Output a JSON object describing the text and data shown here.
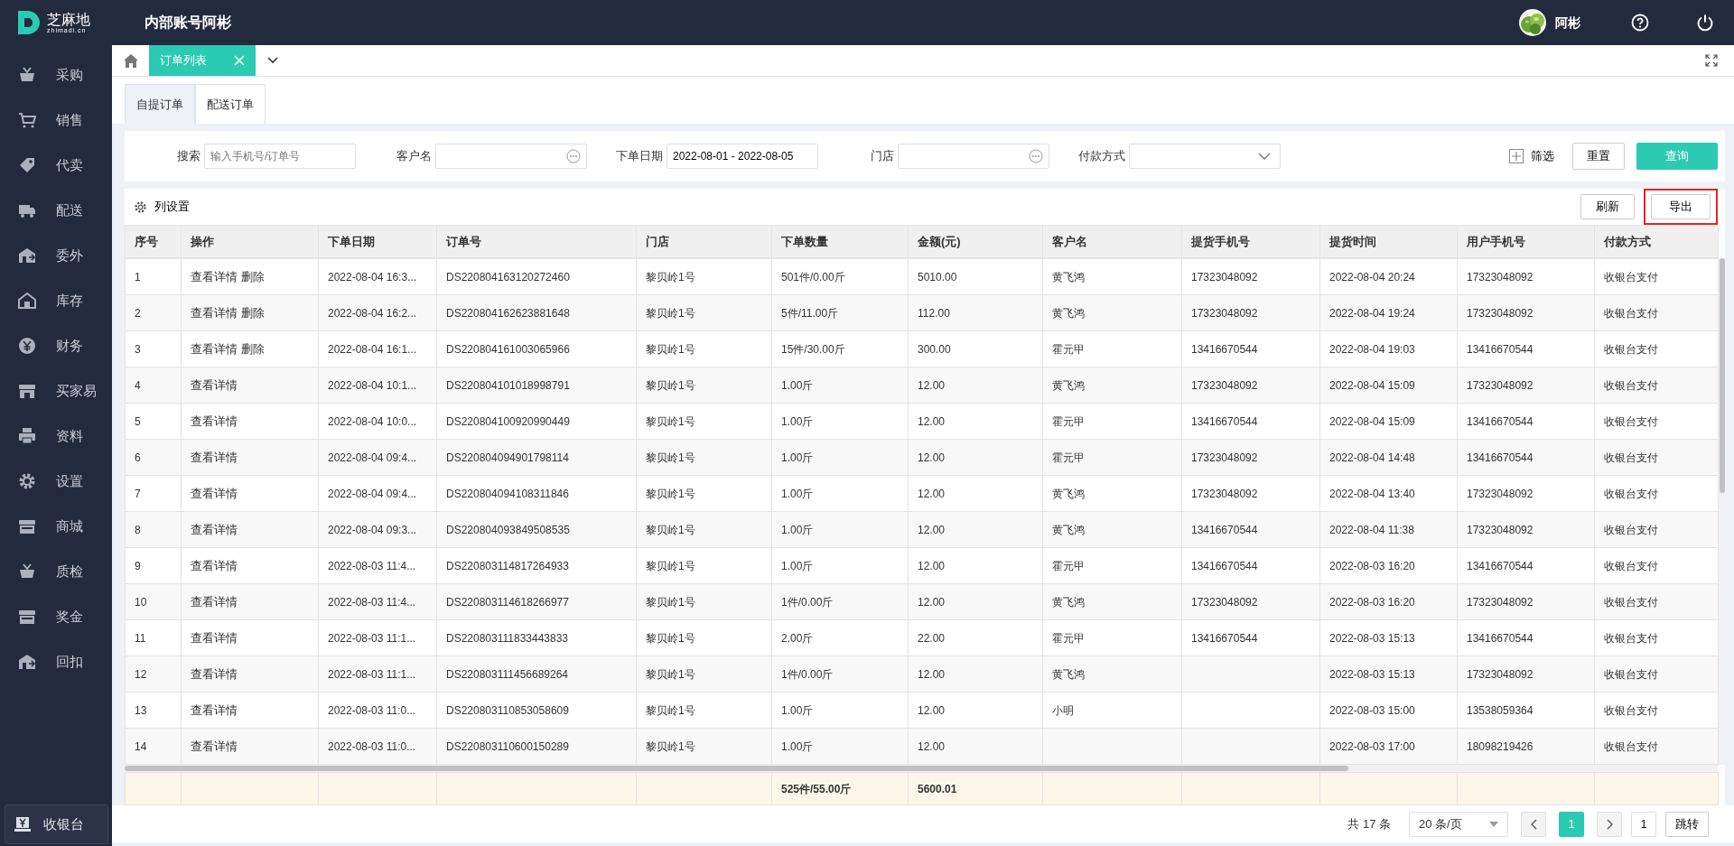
{
  "app": {
    "logo_name": "芝麻地",
    "logo_domain": "zhimadi.cn",
    "account_title": "内部账号阿彬",
    "user_name": "阿彬"
  },
  "sidebar": {
    "items": [
      {
        "label": "采购"
      },
      {
        "label": "销售"
      },
      {
        "label": "代卖"
      },
      {
        "label": "配送"
      },
      {
        "label": "委外"
      },
      {
        "label": "库存"
      },
      {
        "label": "财务"
      },
      {
        "label": "买家易"
      },
      {
        "label": "资料"
      },
      {
        "label": "设置"
      },
      {
        "label": "商城"
      },
      {
        "label": "质检"
      },
      {
        "label": "奖金"
      },
      {
        "label": "回扣"
      }
    ],
    "cashier_button": "收银台"
  },
  "page_tabs": [
    {
      "label": "订单列表",
      "selected": true
    }
  ],
  "order_tabs": [
    {
      "label": "自提订单",
      "selected": true
    },
    {
      "label": "配送订单",
      "selected": false
    }
  ],
  "filters": [
    {
      "kind": "text",
      "label": "搜索",
      "placeholder": "输入手机号/订单号"
    },
    {
      "kind": "picker",
      "label": "客户名"
    },
    {
      "kind": "text",
      "label": "下单日期",
      "value": "2022-08-01 - 2022-08-05"
    },
    {
      "kind": "picker",
      "label": "门店"
    },
    {
      "kind": "select",
      "label": "付款方式"
    }
  ],
  "filter_actions": {
    "more": "筛选",
    "reset": "重置",
    "query": "查询"
  },
  "toolbar": {
    "column_settings": "列设置",
    "refresh": "刷新",
    "export": "导出",
    "export_highlighted": true
  },
  "table": {
    "columns": [
      "序号",
      "操作",
      "下单日期",
      "订单号",
      "门店",
      "下单数量",
      "金额(元)",
      "客户名",
      "提货手机号",
      "提货时间",
      "用户手机号",
      "付款方式"
    ],
    "rows": [
      {
        "cells": [
          "1",
          [
            "查看详情",
            "删除"
          ],
          "2022-08-04 16:3...",
          "DS220804163120272460",
          "黎贝岭1号",
          "501件/0.00斤",
          "5010.00",
          "黄飞鸿",
          "17323048092",
          "2022-08-04 20:24",
          "17323048092",
          "收银台支付"
        ]
      },
      {
        "cells": [
          "2",
          [
            "查看详情",
            "删除"
          ],
          "2022-08-04 16:2...",
          "DS220804162623881648",
          "黎贝岭1号",
          "5件/11.00斤",
          "112.00",
          "黄飞鸿",
          "17323048092",
          "2022-08-04 19:24",
          "17323048092",
          "收银台支付"
        ]
      },
      {
        "cells": [
          "3",
          [
            "查看详情",
            "删除"
          ],
          "2022-08-04 16:1...",
          "DS220804161003065966",
          "黎贝岭1号",
          "15件/30.00斤",
          "300.00",
          "霍元甲",
          "13416670544",
          "2022-08-04 19:03",
          "13416670544",
          "收银台支付"
        ]
      },
      {
        "cells": [
          "4",
          [
            "查看详情"
          ],
          "2022-08-04 10:1...",
          "DS220804101018998791",
          "黎贝岭1号",
          "1.00斤",
          "12.00",
          "黄飞鸿",
          "17323048092",
          "2022-08-04 15:09",
          "17323048092",
          "收银台支付"
        ]
      },
      {
        "cells": [
          "5",
          [
            "查看详情"
          ],
          "2022-08-04 10:0...",
          "DS220804100920990449",
          "黎贝岭1号",
          "1.00斤",
          "12.00",
          "霍元甲",
          "13416670544",
          "2022-08-04 15:09",
          "13416670544",
          "收银台支付"
        ]
      },
      {
        "cells": [
          "6",
          [
            "查看详情"
          ],
          "2022-08-04 09:4...",
          "DS220804094901798114",
          "黎贝岭1号",
          "1.00斤",
          "12.00",
          "霍元甲",
          "17323048092",
          "2022-08-04 14:48",
          "13416670544",
          "收银台支付"
        ]
      },
      {
        "cells": [
          "7",
          [
            "查看详情"
          ],
          "2022-08-04 09:4...",
          "DS220804094108311846",
          "黎贝岭1号",
          "1.00斤",
          "12.00",
          "黄飞鸿",
          "17323048092",
          "2022-08-04 13:40",
          "17323048092",
          "收银台支付"
        ]
      },
      {
        "cells": [
          "8",
          [
            "查看详情"
          ],
          "2022-08-04 09:3...",
          "DS220804093849508535",
          "黎贝岭1号",
          "1.00斤",
          "12.00",
          "黄飞鸿",
          "13416670544",
          "2022-08-04 11:38",
          "17323048092",
          "收银台支付"
        ]
      },
      {
        "cells": [
          "9",
          [
            "查看详情"
          ],
          "2022-08-03 11:4...",
          "DS220803114817264933",
          "黎贝岭1号",
          "1.00斤",
          "12.00",
          "霍元甲",
          "13416670544",
          "2022-08-03 16:20",
          "13416670544",
          "收银台支付"
        ]
      },
      {
        "cells": [
          "10",
          [
            "查看详情"
          ],
          "2022-08-03 11:4...",
          "DS220803114618266977",
          "黎贝岭1号",
          "1件/0.00斤",
          "12.00",
          "黄飞鸿",
          "17323048092",
          "2022-08-03 16:20",
          "17323048092",
          "收银台支付"
        ]
      },
      {
        "cells": [
          "11",
          [
            "查看详情"
          ],
          "2022-08-03 11:1...",
          "DS220803111833443833",
          "黎贝岭1号",
          "2.00斤",
          "22.00",
          "霍元甲",
          "13416670544",
          "2022-08-03 15:13",
          "13416670544",
          "收银台支付"
        ]
      },
      {
        "cells": [
          "12",
          [
            "查看详情"
          ],
          "2022-08-03 11:1...",
          "DS220803111456689264",
          "黎贝岭1号",
          "1件/0.00斤",
          "12.00",
          "黄飞鸿",
          "",
          "2022-08-03 15:13",
          "17323048092",
          "收银台支付"
        ]
      },
      {
        "cells": [
          "13",
          [
            "查看详情"
          ],
          "2022-08-03 11:0...",
          "DS220803110853058609",
          "黎贝岭1号",
          "1.00斤",
          "12.00",
          "小明",
          "",
          "2022-08-03 15:00",
          "13538059364",
          "收银台支付"
        ]
      },
      {
        "cells": [
          "14",
          [
            "查看详情"
          ],
          "2022-08-03 11:0...",
          "DS220803110600150289",
          "黎贝岭1号",
          "1.00斤",
          "12.00",
          "",
          "",
          "2022-08-03 17:00",
          "18098219426",
          "收银台支付"
        ]
      }
    ],
    "totals": {
      "quantity": "525件/55.00斤",
      "amount": "5600.01"
    }
  },
  "pagination": {
    "total": "共 17 条",
    "page_size": "20 条/页",
    "pages": [
      {
        "label": "1",
        "selected": true
      }
    ],
    "jump_value": "1",
    "jump": "跳转"
  }
}
